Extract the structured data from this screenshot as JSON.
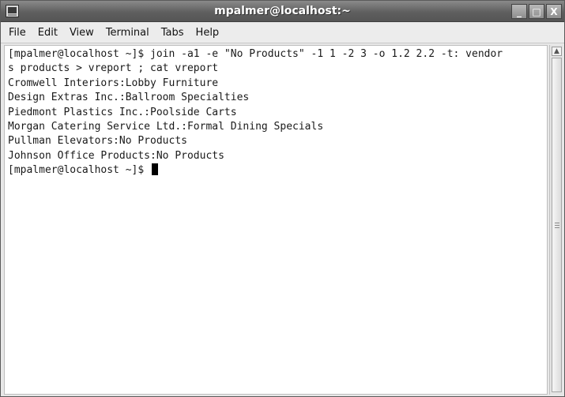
{
  "window": {
    "title": "mpalmer@localhost:~",
    "controls": [
      "_",
      "□",
      "X"
    ]
  },
  "menubar": {
    "items": [
      "File",
      "Edit",
      "View",
      "Terminal",
      "Tabs",
      "Help"
    ]
  },
  "terminal": {
    "lines": [
      "[mpalmer@localhost ~]$ join -a1 -e \"No Products\" -1 1 -2 3 -o 1.2 2.2 -t: vendor",
      "s products > vreport ; cat vreport",
      "Cromwell Interiors:Lobby Furniture",
      "Design Extras Inc.:Ballroom Specialties",
      "Piedmont Plastics Inc.:Poolside Carts",
      "Morgan Catering Service Ltd.:Formal Dining Specials",
      "Pullman Elevators:No Products",
      "Johnson Office Products:No Products"
    ],
    "prompt": "[mpalmer@localhost ~]$ "
  }
}
